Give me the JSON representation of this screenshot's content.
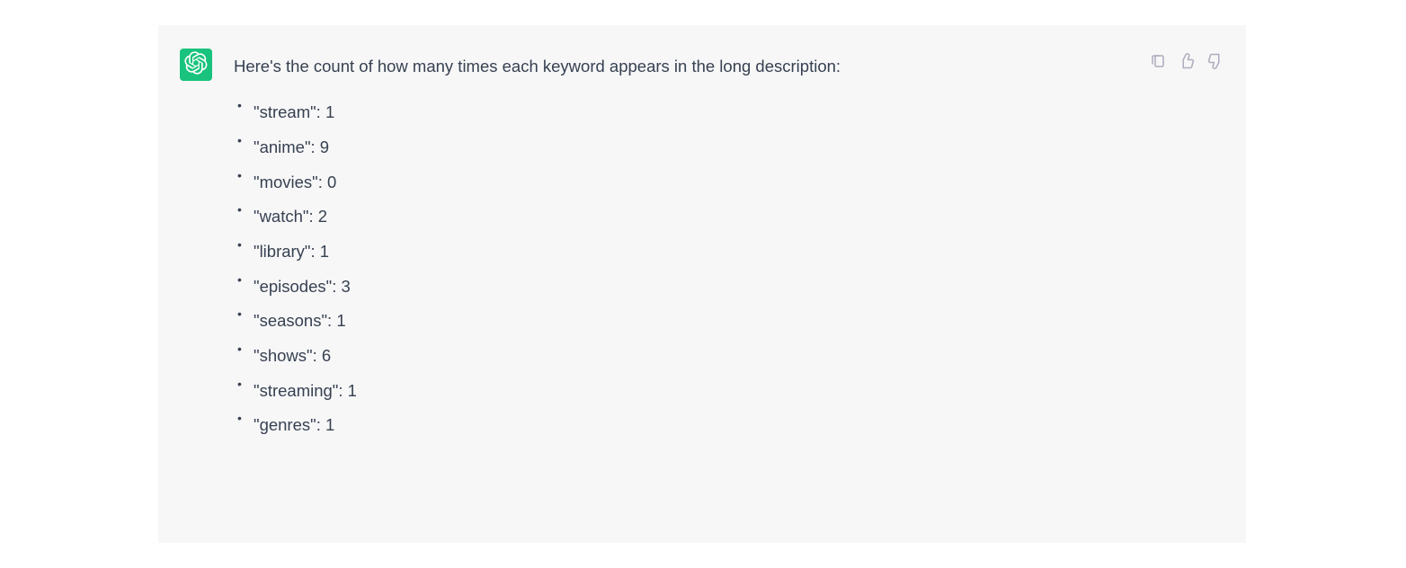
{
  "message": {
    "intro": "Here's the count of how many times each keyword appears in the long description:",
    "items": [
      "\"stream\": 1",
      "\"anime\": 9",
      "\"movies\": 0",
      "\"watch\": 2",
      "\"library\": 1",
      "\"episodes\": 3",
      "\"seasons\": 1",
      "\"shows\": 6",
      "\"streaming\": 1",
      "\"genres\": 1"
    ]
  }
}
